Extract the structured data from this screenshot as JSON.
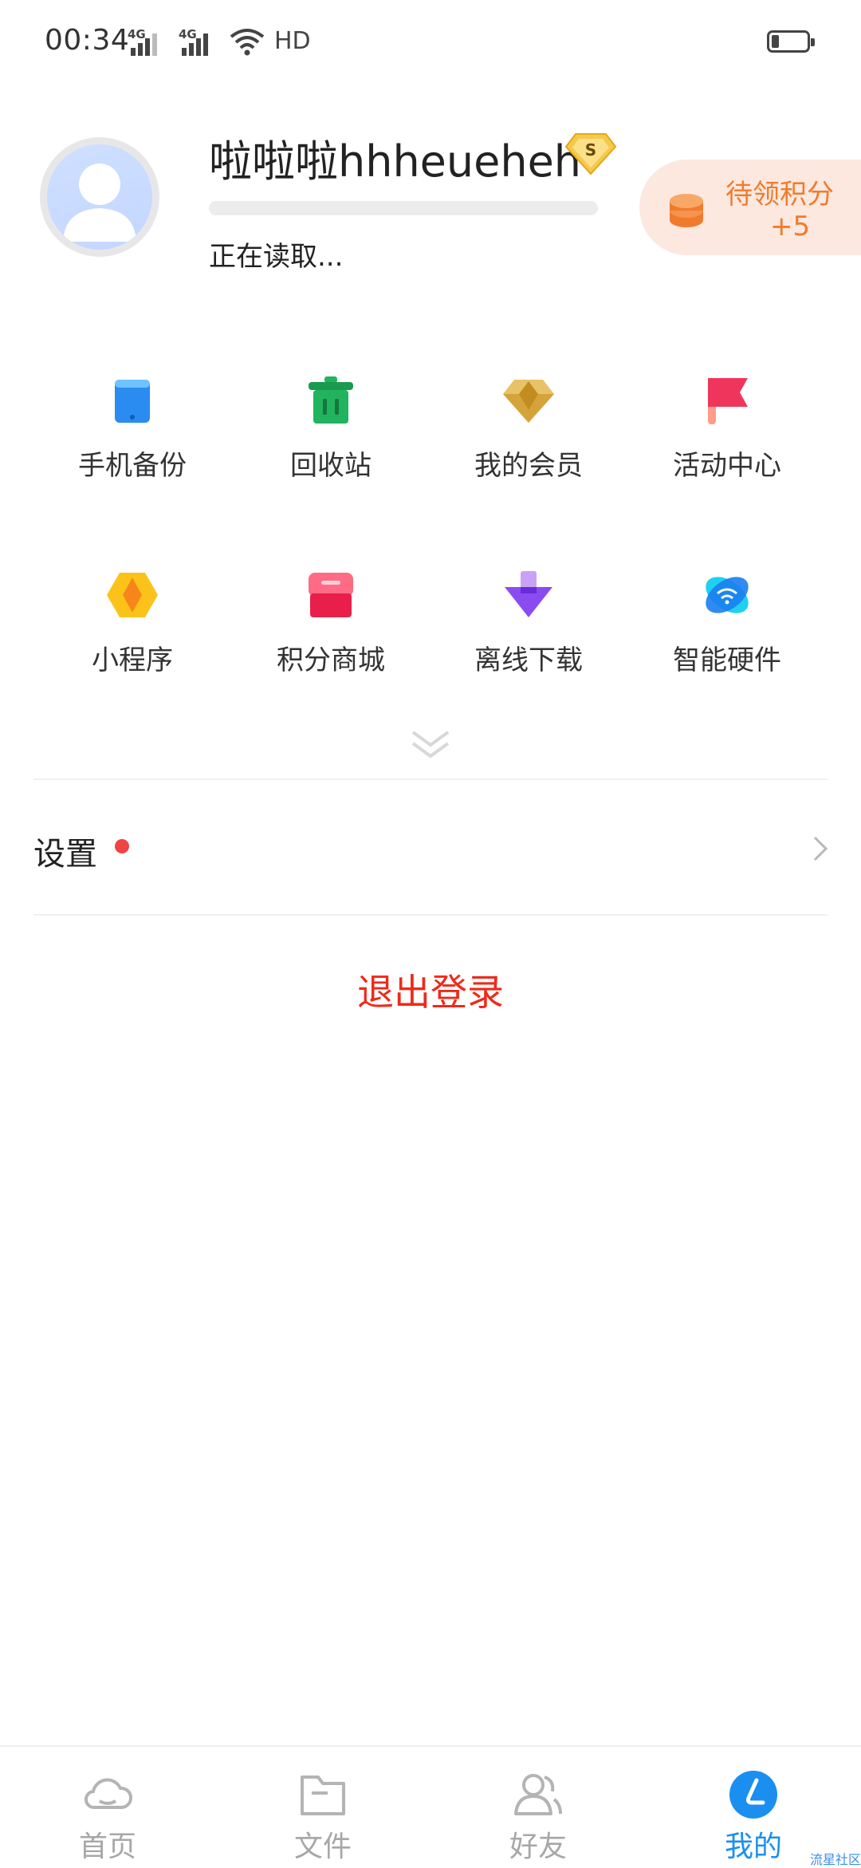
{
  "status_bar": {
    "time": "00:34",
    "network_1": "4G",
    "network_2": "4G",
    "hd_label": "HD"
  },
  "profile": {
    "username": "啦啦啦hhheueheh",
    "vip_badge_letter": "S",
    "loading_text": "正在读取...",
    "points_label": "待领积分",
    "points_value": "+5"
  },
  "grid": [
    {
      "label": "手机备份",
      "icon": "phone-backup-icon",
      "color": "#2a8cf0"
    },
    {
      "label": "回收站",
      "icon": "recycle-bin-icon",
      "color": "#22b35e"
    },
    {
      "label": "我的会员",
      "icon": "diamond-icon",
      "color": "#e0b552"
    },
    {
      "label": "活动中心",
      "icon": "flag-icon",
      "color": "#f0355c"
    },
    {
      "label": "小程序",
      "icon": "mini-program-icon",
      "color": "#fbc31a"
    },
    {
      "label": "积分商城",
      "icon": "store-icon",
      "color": "#f04a6a"
    },
    {
      "label": "离线下载",
      "icon": "download-arrow-icon",
      "color": "#8a4cf0"
    },
    {
      "label": "智能硬件",
      "icon": "smart-hardware-icon",
      "color": "#1a7df0"
    }
  ],
  "settings": {
    "label": "设置"
  },
  "logout_label": "退出登录",
  "bottom_nav": [
    {
      "label": "首页",
      "icon": "cloud-icon",
      "active": false
    },
    {
      "label": "文件",
      "icon": "folder-icon",
      "active": false
    },
    {
      "label": "好友",
      "icon": "friends-icon",
      "active": false
    },
    {
      "label": "我的",
      "icon": "me-icon",
      "active": true
    }
  ],
  "watermark": "流星社区",
  "colors": {
    "accent": "#1a8ff0",
    "logout": "#ee2a1a",
    "points": "#f07b2d",
    "points_bg": "#fde8df",
    "inactive": "#a7a7a7"
  }
}
